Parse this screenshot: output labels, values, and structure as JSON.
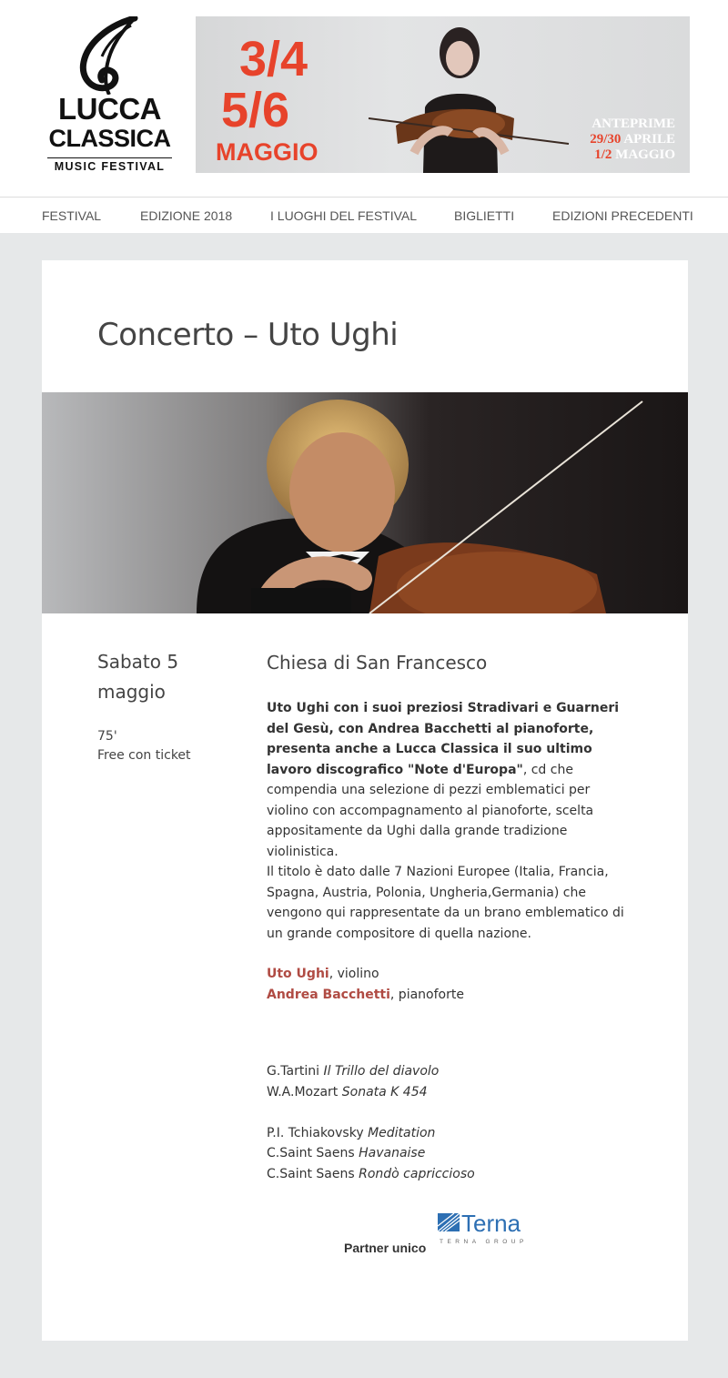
{
  "header": {
    "logo": {
      "line1": "LUCCA",
      "line2": "CLASSICA",
      "line3": "MUSIC FESTIVAL"
    },
    "banner": {
      "date_line1": "3/4",
      "date_line2": "5/6",
      "month": "MAGGIO",
      "anteprime_label": "ANTEPRIME",
      "anteprime_date1": "29/30",
      "anteprime_month1": "APRILE",
      "anteprime_date2": "1/2",
      "anteprime_month2": "MAGGIO"
    }
  },
  "nav": {
    "items": [
      {
        "label": "FESTIVAL"
      },
      {
        "label": "EDIZIONE 2018"
      },
      {
        "label": "I LUOGHI DEL FESTIVAL"
      },
      {
        "label": "BIGLIETTI"
      },
      {
        "label": "EDIZIONI PRECEDENTI"
      }
    ]
  },
  "event": {
    "title": "Concerto – Uto Ughi",
    "date_line1": "Sabato 5",
    "date_line2": "maggio",
    "duration": "75'",
    "ticket": "Free con ticket",
    "venue": "Chiesa di San Francesco",
    "desc_bold": "Uto Ughi con i suoi preziosi Stradivari e Guarneri del Gesù, con Andrea Bacchetti al pianoforte, presenta anche a Lucca Classica il suo ultimo lavoro discografico \"Note d'Europa\"",
    "desc_rest": ", cd che compendia una selezione di pezzi emblematici per violino con accompagnamento al pianoforte, scelta appositamente da Ughi dalla grande tradizione violinistica.",
    "desc_para2": "Il titolo è dato dalle 7 Nazioni Europee (Italia, Francia, Spagna, Austria, Polonia, Ungheria,Germania) che vengono qui rappresentate da un brano emblematico di un grande compositore di quella nazione.",
    "performers": [
      {
        "name": "Uto Ughi",
        "role": ", violino"
      },
      {
        "name": "Andrea Bacchetti",
        "role": ", pianoforte"
      }
    ],
    "program": [
      {
        "composer": "G.Tartini ",
        "work": "Il Trillo del diavolo"
      },
      {
        "composer": "W.A.Mozart ",
        "work": "Sonata K 454"
      },
      {
        "composer": "P.I. Tchiakovsky ",
        "work": "Meditation"
      },
      {
        "composer": "C.Saint Saens ",
        "work": "Havanaise"
      },
      {
        "composer": "C.Saint Saens ",
        "work": "Rondò capriccioso"
      }
    ],
    "partner_label": "Partner unico",
    "partner_logo_text": "Terna",
    "partner_logo_sub": "TERNA GROUP"
  },
  "colors": {
    "accent_red": "#e7432b",
    "performer_red": "#b04b43",
    "terna_blue": "#2d6fb3"
  }
}
